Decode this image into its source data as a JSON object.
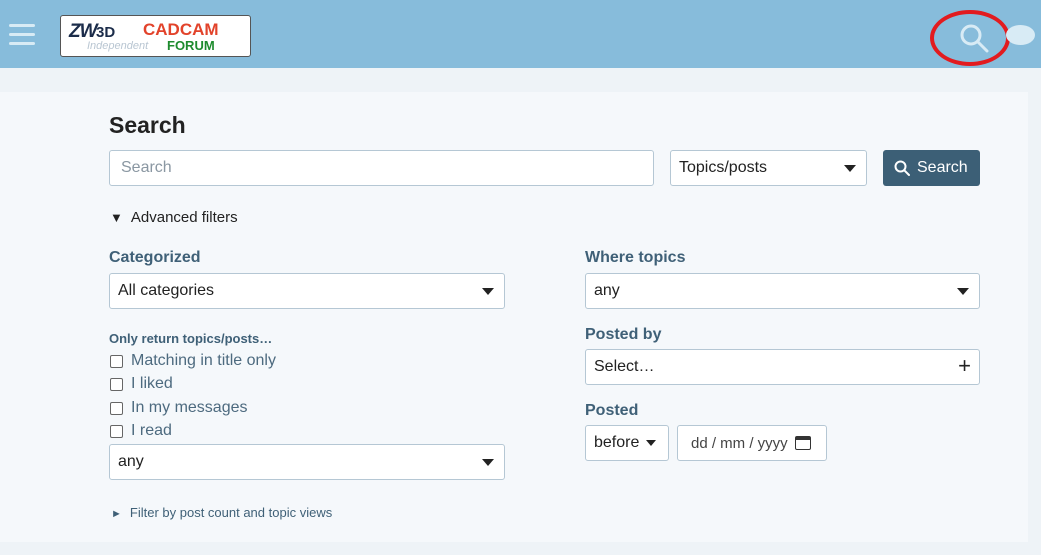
{
  "header": {
    "logo": {
      "zw": "ZW",
      "three_d": "3D",
      "cadcam": "CADCAM",
      "independent": "Independent",
      "forum": "FORUM"
    },
    "menu_icon": "hamburger-icon",
    "search_icon": "search-icon",
    "chat_icon": "chat-bubble-icon"
  },
  "search": {
    "title": "Search",
    "input_placeholder": "Search",
    "type_select": "Topics/posts",
    "button_label": "Search",
    "advanced_toggle": "Advanced filters"
  },
  "left": {
    "categorized_label": "Categorized",
    "categories_value": "All categories",
    "only_return_label": "Only return topics/posts…",
    "checkboxes": [
      "Matching in title only",
      "I liked",
      "In my messages",
      "I read"
    ],
    "status_value": "any",
    "filter_link": "Filter by post count and topic views"
  },
  "right": {
    "where_topics_label": "Where topics",
    "where_topics_value": "any",
    "posted_by_label": "Posted by",
    "posted_by_placeholder": "Select…",
    "posted_label": "Posted",
    "posted_when": "before",
    "date_placeholder": "dd / mm / yyyy"
  },
  "colors": {
    "header": "#87bcdb",
    "primary_button": "#3c5f76",
    "label_text": "#3f6077",
    "highlight_ring": "#e21b1f"
  }
}
